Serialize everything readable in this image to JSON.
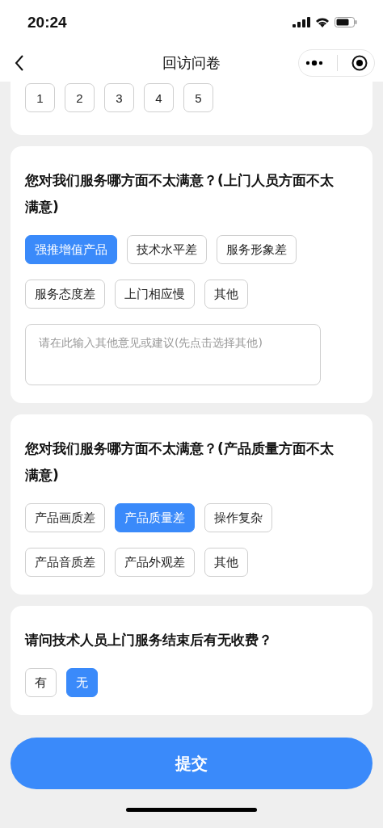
{
  "status_bar": {
    "time": "20:24"
  },
  "nav": {
    "title": "回访问卷"
  },
  "questions": [
    {
      "kind": "rating",
      "options": [
        {
          "label": "1",
          "selected": false
        },
        {
          "label": "2",
          "selected": false
        },
        {
          "label": "3",
          "selected": false
        },
        {
          "label": "4",
          "selected": false
        },
        {
          "label": "5",
          "selected": false
        }
      ]
    },
    {
      "kind": "choice",
      "title": "您对我们服务哪方面不太满意？(上门人员方面不太满意)",
      "options": [
        {
          "label": "强推增值产品",
          "selected": true
        },
        {
          "label": "技术水平差",
          "selected": false
        },
        {
          "label": "服务形象差",
          "selected": false
        },
        {
          "label": "服务态度差",
          "selected": false
        },
        {
          "label": "上门相应慢",
          "selected": false
        },
        {
          "label": "其他",
          "selected": false
        }
      ],
      "text_field": {
        "placeholder": "请在此输入其他意见或建议(先点击选择其他)"
      }
    },
    {
      "kind": "choice",
      "title": "您对我们服务哪方面不太满意？(产品质量方面不太满意)",
      "options": [
        {
          "label": "产品画质差",
          "selected": false
        },
        {
          "label": "产品质量差",
          "selected": true
        },
        {
          "label": "操作复杂",
          "selected": false
        },
        {
          "label": "产品音质差",
          "selected": false
        },
        {
          "label": "产品外观差",
          "selected": false
        },
        {
          "label": "其他",
          "selected": false
        }
      ]
    },
    {
      "kind": "choice",
      "title": "请问技术人员上门服务结束后有无收费？",
      "options": [
        {
          "label": "有",
          "selected": false
        },
        {
          "label": "无",
          "selected": true
        }
      ]
    }
  ],
  "submit": {
    "label": "提交"
  }
}
